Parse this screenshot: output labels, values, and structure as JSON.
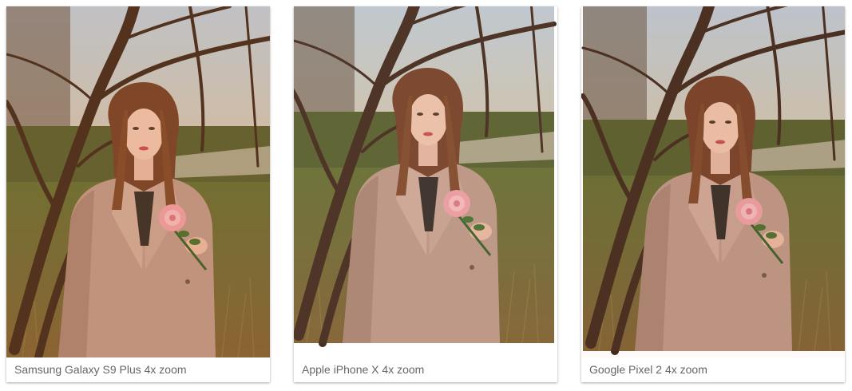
{
  "gallery": {
    "cards": [
      {
        "caption": "Samsung Galaxy S9 Plus 4x zoom"
      },
      {
        "caption": "Apple iPhone X 4x zoom"
      },
      {
        "caption": "Google Pixel 2 4x zoom"
      }
    ]
  },
  "colors": {
    "page_background": "#ffffff",
    "caption_text": "#666666",
    "coat": "#b89384",
    "sky": "#b7c8d8",
    "grass": "#5e6a2e"
  }
}
